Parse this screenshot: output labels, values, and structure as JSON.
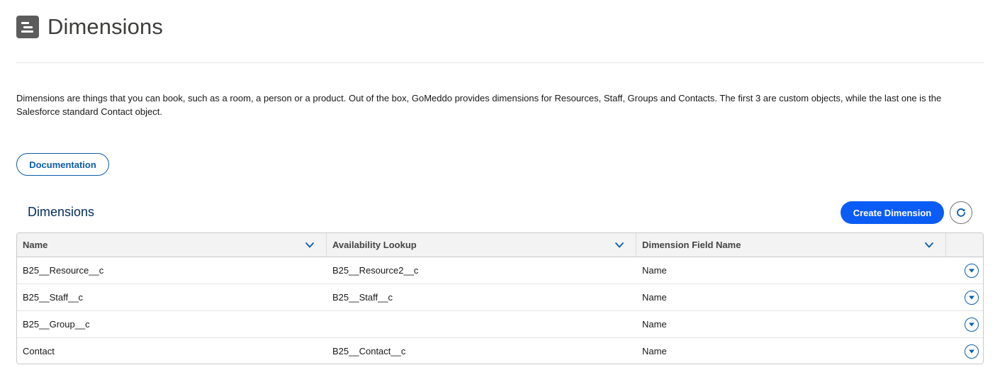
{
  "header": {
    "title": "Dimensions",
    "icon": "list-icon"
  },
  "description": "Dimensions are things that you can book, such as a room, a person or a product. Out of the box, GoMeddo provides dimensions for Resources, Staff, Groups and Contacts. The first 3 are custom objects, while the last one is the Salesforce standard Contact object.",
  "documentation_button": "Documentation",
  "section": {
    "title": "Dimensions",
    "create_button": "Create Dimension",
    "refresh_icon": "refresh-icon"
  },
  "table": {
    "columns": [
      {
        "label": "Name"
      },
      {
        "label": "Availability Lookup"
      },
      {
        "label": "Dimension Field Name"
      }
    ],
    "rows": [
      {
        "name": "B25__Resource__c",
        "availability_lookup": "B25__Resource2__c",
        "field_name": "Name"
      },
      {
        "name": "B25__Staff__c",
        "availability_lookup": "B25__Staff__c",
        "field_name": "Name"
      },
      {
        "name": "B25__Group__c",
        "availability_lookup": "",
        "field_name": "Name"
      },
      {
        "name": "Contact",
        "availability_lookup": "B25__Contact__c",
        "field_name": "Name"
      }
    ]
  },
  "colors": {
    "brand_blue": "#0b5cf5",
    "link_blue": "#0b5cab",
    "header_icon": "#5c5c5c"
  }
}
